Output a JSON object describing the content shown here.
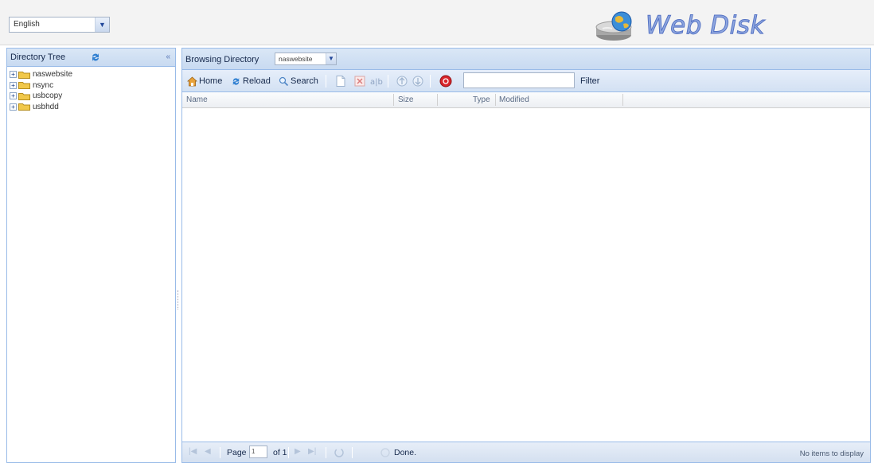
{
  "header": {
    "language": {
      "value": "English"
    },
    "logo_text": "Web Disk"
  },
  "tree_panel": {
    "title": "Directory Tree",
    "items": [
      {
        "label": "naswebsite"
      },
      {
        "label": "nsync"
      },
      {
        "label": "usbcopy"
      },
      {
        "label": "usbhdd"
      }
    ]
  },
  "browse": {
    "label": "Browsing Directory",
    "directory": "naswebsite"
  },
  "toolbar": {
    "home_label": "Home",
    "reload_label": "Reload",
    "search_label": "Search",
    "filter_label": "Filter",
    "filter_value": ""
  },
  "grid": {
    "columns": [
      "Name",
      "Size",
      "Type",
      "Modified"
    ]
  },
  "paging": {
    "page_label": "Page",
    "page_value": "1",
    "of_label": "of 1",
    "status": "Done.",
    "display_text": "No items to display"
  },
  "colors": {
    "panel_border": "#99bbe8",
    "header_gradient_top": "#dae7f6",
    "logo_text": "#8fa7df",
    "folder": "#f1c84a"
  }
}
